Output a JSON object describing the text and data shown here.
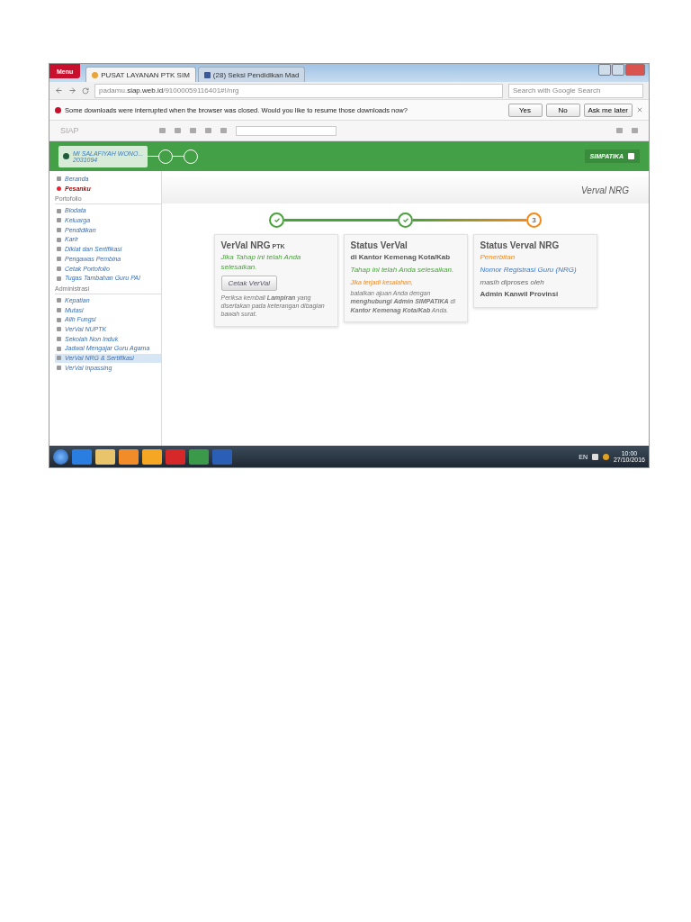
{
  "browser": {
    "menu_label": "Menu",
    "tabs": [
      {
        "title": "PUSAT LAYANAN PTK SIM",
        "selected": true
      },
      {
        "title": "(28) Seksi Pendidikan Mad",
        "selected": false
      }
    ],
    "address": "padamu.**siap.web.id**/91000059116401#!/nrg",
    "search_placeholder": "Search with Google Search",
    "download_bar": {
      "message": "Some downloads were interrupted when the browser was closed. Would you like to resume those downloads now?",
      "buttons": [
        "Yes",
        "No",
        "Ask me later"
      ]
    }
  },
  "app": {
    "logo": "SIAP",
    "header": {
      "school_name": "MI SALAFIYAH WONO...",
      "school_id": "2031094",
      "brand": "SIMPATIKA"
    },
    "page_title": "Verval NRG",
    "sidebar": [
      {
        "kind": "item",
        "label": "Beranda",
        "selected": false
      },
      {
        "kind": "alert",
        "label": "Pesanku",
        "selected": false
      },
      {
        "kind": "heading",
        "label": "Portofolio"
      },
      {
        "kind": "item",
        "label": "Biodata",
        "selected": false
      },
      {
        "kind": "item",
        "label": "Keluarga",
        "selected": false
      },
      {
        "kind": "item",
        "label": "Pendidikan",
        "selected": false
      },
      {
        "kind": "item",
        "label": "Karir",
        "selected": false
      },
      {
        "kind": "item",
        "label": "Diklat dan Sertifikasi",
        "selected": false
      },
      {
        "kind": "item",
        "label": "Pengawas Pembina",
        "selected": false
      },
      {
        "kind": "item",
        "label": "Cetak Portofolio",
        "selected": false
      },
      {
        "kind": "item",
        "label": "Tugas Tambahan Guru PAI",
        "selected": false
      },
      {
        "kind": "heading",
        "label": "Administrasi"
      },
      {
        "kind": "item",
        "label": "Kepatian",
        "selected": false
      },
      {
        "kind": "item",
        "label": "Mutasi",
        "selected": false
      },
      {
        "kind": "item",
        "label": "Alih Fungsi",
        "selected": false
      },
      {
        "kind": "item",
        "label": "VerVal NUPTK",
        "selected": false
      },
      {
        "kind": "item",
        "label": "Sekolah Non Induk",
        "selected": false
      },
      {
        "kind": "item",
        "label": "Jadwal Mengajar Guru Agama",
        "selected": false
      },
      {
        "kind": "item",
        "label": "VerVal NRG & Sertifikasi",
        "selected": true
      },
      {
        "kind": "item",
        "label": "VerVal Inpassing",
        "selected": false
      }
    ],
    "steps": [
      {
        "done": true
      },
      {
        "done": true
      },
      {
        "done": false,
        "label": "3"
      }
    ],
    "cards": [
      {
        "title": "VerVal NRG",
        "title_suffix": "PTK",
        "lines": [
          {
            "kind": "success",
            "text": "Jika Tahap ini telah Anda selesaikan."
          },
          {
            "kind": "button",
            "text": "Cetak VerVal"
          },
          {
            "kind": "note",
            "text": "Periksa kembali **Lampiran** yang disertakan pada keterangan dibagian bawah surat."
          }
        ]
      },
      {
        "title": "Status VerVal",
        "lines": [
          {
            "kind": "subtitle",
            "text": "di Kantor Kemenag Kota/Kab"
          },
          {
            "kind": "success",
            "text": "Tahap ini telah Anda selesaikan."
          },
          {
            "kind": "warning_small",
            "text": "Jika terjadi kesalahan,"
          },
          {
            "kind": "note",
            "text": "batalkan ajuan Anda dengan **menghubungi Admin SIMPATIKA** di **Kantor Kemenag Kota/Kab** Anda."
          }
        ]
      },
      {
        "title": "Status Verval NRG",
        "lines": [
          {
            "kind": "warning",
            "text": "Penerbitan"
          },
          {
            "kind": "link",
            "text": "Nomor Registrasi Guru (NRG)"
          },
          {
            "kind": "plain",
            "text": "masih diproses oleh"
          },
          {
            "kind": "strong",
            "text": "Admin Kanwil Provinsi"
          }
        ]
      }
    ]
  },
  "taskbar": {
    "language": "EN",
    "time": "10:00",
    "date": "27/10/2016"
  }
}
